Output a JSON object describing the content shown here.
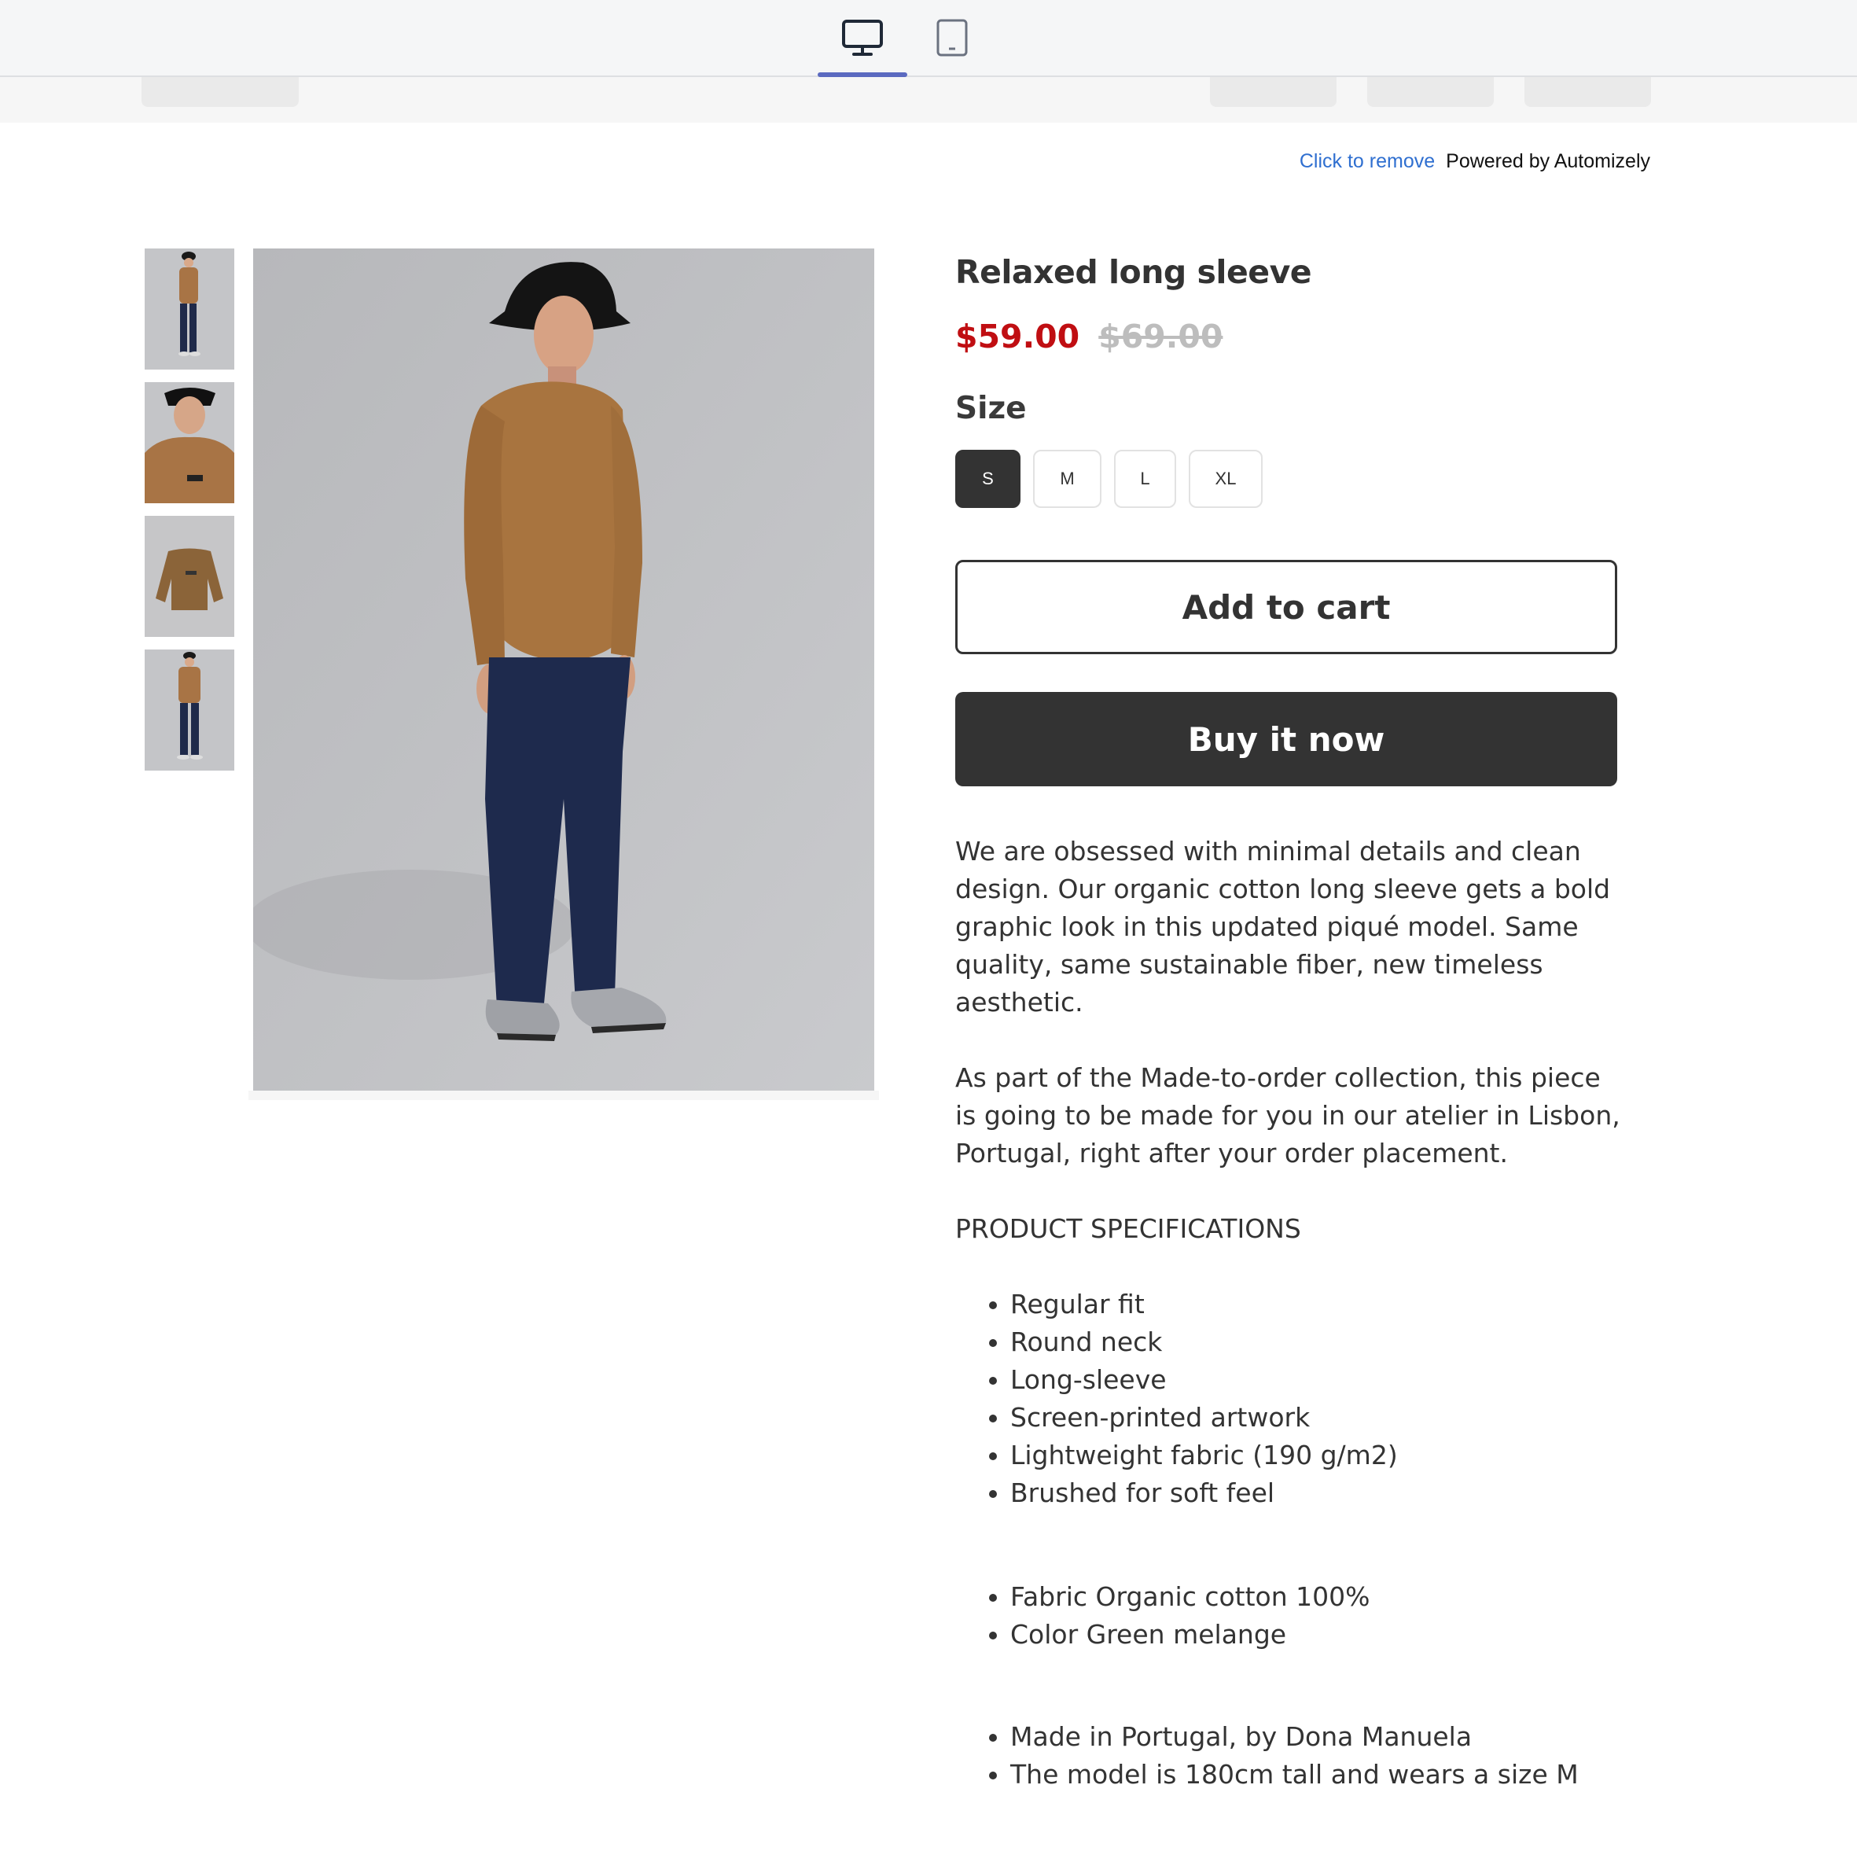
{
  "toolbar": {
    "desktop_icon": "desktop-monitor-icon",
    "tablet_icon": "tablet-icon",
    "active_device": "desktop",
    "accent_color": "#5b6ac0"
  },
  "powered_by": {
    "remove_label": "Click to remove",
    "brand_label": "Powered by Automizely"
  },
  "gallery": {
    "thumbnails": [
      "thumbnail-full-body-front",
      "thumbnail-close-up",
      "thumbnail-flat-shirt",
      "thumbnail-full-body"
    ]
  },
  "product": {
    "title": "Relaxed long sleeve",
    "price": "$59.00",
    "compare_price": "$69.00",
    "price_color": "#c00e12",
    "size_label": "Size",
    "sizes": [
      "S",
      "M",
      "L",
      "XL"
    ],
    "selected_size": "S",
    "add_to_cart_label": "Add to cart",
    "buy_now_label": "Buy it now",
    "description": {
      "paragraph_1": "We are obsessed with minimal details and clean design. Our organic cotton long sleeve gets a bold graphic look in this updated piqué model. Same quality, same sustainable fiber, new timeless aesthetic.",
      "paragraph_2": "As part of the Made-to-order collection, this piece is going to be made for you in our atelier in Lisbon, Portugal, right after your order placement.",
      "specs_heading": "PRODUCT SPECIFICATIONS",
      "spec_group_1": [
        "Regular fit",
        "Round neck",
        "Long-sleeve",
        "Screen-printed artwork",
        "Lightweight fabric (190 g/m2)",
        "Brushed for soft feel"
      ],
      "spec_group_2": [
        "Fabric Organic cotton 100%",
        "Color Green melange"
      ],
      "spec_group_3": [
        "Made in Portugal, by Dona Manuela",
        "The model is 180cm tall and wears a size M"
      ]
    }
  }
}
